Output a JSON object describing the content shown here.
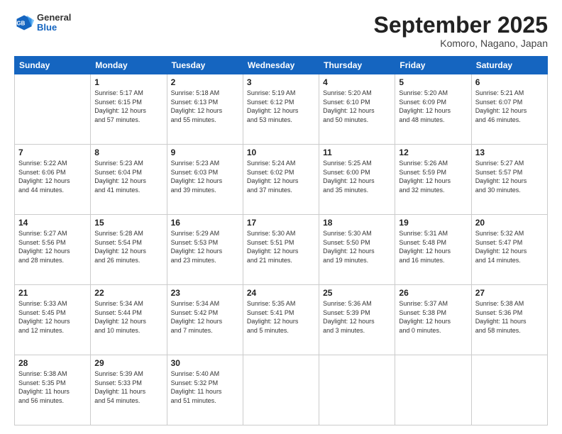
{
  "header": {
    "logo": {
      "general": "General",
      "blue": "Blue"
    },
    "title": "September 2025",
    "location": "Komoro, Nagano, Japan"
  },
  "weekdays": [
    "Sunday",
    "Monday",
    "Tuesday",
    "Wednesday",
    "Thursday",
    "Friday",
    "Saturday"
  ],
  "weeks": [
    [
      {
        "day": "",
        "info": ""
      },
      {
        "day": "1",
        "info": "Sunrise: 5:17 AM\nSunset: 6:15 PM\nDaylight: 12 hours\nand 57 minutes."
      },
      {
        "day": "2",
        "info": "Sunrise: 5:18 AM\nSunset: 6:13 PM\nDaylight: 12 hours\nand 55 minutes."
      },
      {
        "day": "3",
        "info": "Sunrise: 5:19 AM\nSunset: 6:12 PM\nDaylight: 12 hours\nand 53 minutes."
      },
      {
        "day": "4",
        "info": "Sunrise: 5:20 AM\nSunset: 6:10 PM\nDaylight: 12 hours\nand 50 minutes."
      },
      {
        "day": "5",
        "info": "Sunrise: 5:20 AM\nSunset: 6:09 PM\nDaylight: 12 hours\nand 48 minutes."
      },
      {
        "day": "6",
        "info": "Sunrise: 5:21 AM\nSunset: 6:07 PM\nDaylight: 12 hours\nand 46 minutes."
      }
    ],
    [
      {
        "day": "7",
        "info": "Sunrise: 5:22 AM\nSunset: 6:06 PM\nDaylight: 12 hours\nand 44 minutes."
      },
      {
        "day": "8",
        "info": "Sunrise: 5:23 AM\nSunset: 6:04 PM\nDaylight: 12 hours\nand 41 minutes."
      },
      {
        "day": "9",
        "info": "Sunrise: 5:23 AM\nSunset: 6:03 PM\nDaylight: 12 hours\nand 39 minutes."
      },
      {
        "day": "10",
        "info": "Sunrise: 5:24 AM\nSunset: 6:02 PM\nDaylight: 12 hours\nand 37 minutes."
      },
      {
        "day": "11",
        "info": "Sunrise: 5:25 AM\nSunset: 6:00 PM\nDaylight: 12 hours\nand 35 minutes."
      },
      {
        "day": "12",
        "info": "Sunrise: 5:26 AM\nSunset: 5:59 PM\nDaylight: 12 hours\nand 32 minutes."
      },
      {
        "day": "13",
        "info": "Sunrise: 5:27 AM\nSunset: 5:57 PM\nDaylight: 12 hours\nand 30 minutes."
      }
    ],
    [
      {
        "day": "14",
        "info": "Sunrise: 5:27 AM\nSunset: 5:56 PM\nDaylight: 12 hours\nand 28 minutes."
      },
      {
        "day": "15",
        "info": "Sunrise: 5:28 AM\nSunset: 5:54 PM\nDaylight: 12 hours\nand 26 minutes."
      },
      {
        "day": "16",
        "info": "Sunrise: 5:29 AM\nSunset: 5:53 PM\nDaylight: 12 hours\nand 23 minutes."
      },
      {
        "day": "17",
        "info": "Sunrise: 5:30 AM\nSunset: 5:51 PM\nDaylight: 12 hours\nand 21 minutes."
      },
      {
        "day": "18",
        "info": "Sunrise: 5:30 AM\nSunset: 5:50 PM\nDaylight: 12 hours\nand 19 minutes."
      },
      {
        "day": "19",
        "info": "Sunrise: 5:31 AM\nSunset: 5:48 PM\nDaylight: 12 hours\nand 16 minutes."
      },
      {
        "day": "20",
        "info": "Sunrise: 5:32 AM\nSunset: 5:47 PM\nDaylight: 12 hours\nand 14 minutes."
      }
    ],
    [
      {
        "day": "21",
        "info": "Sunrise: 5:33 AM\nSunset: 5:45 PM\nDaylight: 12 hours\nand 12 minutes."
      },
      {
        "day": "22",
        "info": "Sunrise: 5:34 AM\nSunset: 5:44 PM\nDaylight: 12 hours\nand 10 minutes."
      },
      {
        "day": "23",
        "info": "Sunrise: 5:34 AM\nSunset: 5:42 PM\nDaylight: 12 hours\nand 7 minutes."
      },
      {
        "day": "24",
        "info": "Sunrise: 5:35 AM\nSunset: 5:41 PM\nDaylight: 12 hours\nand 5 minutes."
      },
      {
        "day": "25",
        "info": "Sunrise: 5:36 AM\nSunset: 5:39 PM\nDaylight: 12 hours\nand 3 minutes."
      },
      {
        "day": "26",
        "info": "Sunrise: 5:37 AM\nSunset: 5:38 PM\nDaylight: 12 hours\nand 0 minutes."
      },
      {
        "day": "27",
        "info": "Sunrise: 5:38 AM\nSunset: 5:36 PM\nDaylight: 11 hours\nand 58 minutes."
      }
    ],
    [
      {
        "day": "28",
        "info": "Sunrise: 5:38 AM\nSunset: 5:35 PM\nDaylight: 11 hours\nand 56 minutes."
      },
      {
        "day": "29",
        "info": "Sunrise: 5:39 AM\nSunset: 5:33 PM\nDaylight: 11 hours\nand 54 minutes."
      },
      {
        "day": "30",
        "info": "Sunrise: 5:40 AM\nSunset: 5:32 PM\nDaylight: 11 hours\nand 51 minutes."
      },
      {
        "day": "",
        "info": ""
      },
      {
        "day": "",
        "info": ""
      },
      {
        "day": "",
        "info": ""
      },
      {
        "day": "",
        "info": ""
      }
    ]
  ]
}
